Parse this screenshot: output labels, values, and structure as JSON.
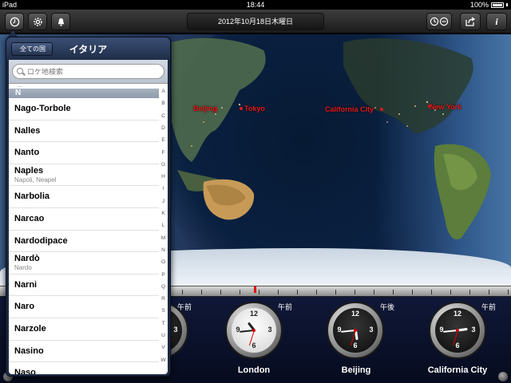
{
  "status_bar": {
    "device": "iPad",
    "time": "18:44",
    "battery": "100%"
  },
  "toolbar": {
    "date": "2012年10月18日木曜日",
    "left_buttons": [
      "clock-icon",
      "gear-icon",
      "bell-icon"
    ],
    "right_buttons": [
      "dual-clock-icon",
      "share-icon",
      "info-icon"
    ],
    "info_label": "i"
  },
  "map": {
    "cities": [
      {
        "name": "Beijing"
      },
      {
        "name": "Tokyo"
      },
      {
        "name": "California City"
      },
      {
        "name": "New York"
      }
    ]
  },
  "clocks": [
    {
      "name": "",
      "ampm": "午前",
      "hour": 8,
      "minute": 44,
      "second": 22,
      "face": "dark"
    },
    {
      "name": "London",
      "ampm": "午前",
      "hour": 10,
      "minute": 44,
      "second": 33,
      "face": "light"
    },
    {
      "name": "Beijing",
      "ampm": "午後",
      "hour": 5,
      "minute": 44,
      "second": 33,
      "face": "dark"
    },
    {
      "name": "California City",
      "ampm": "午前",
      "hour": 2,
      "minute": 44,
      "second": 33,
      "face": "dark"
    }
  ],
  "popover": {
    "back_button": "全ての国",
    "title": "イタリア",
    "search_placeholder": "ロケ地検索",
    "dots": "...",
    "section": "N",
    "items": [
      {
        "name": "Nago-Torbole",
        "alt": ""
      },
      {
        "name": "Nalles",
        "alt": ""
      },
      {
        "name": "Nanto",
        "alt": ""
      },
      {
        "name": "Naples",
        "alt": "Napoli, Neapel"
      },
      {
        "name": "Narbolia",
        "alt": ""
      },
      {
        "name": "Narcao",
        "alt": ""
      },
      {
        "name": "Nardodipace",
        "alt": ""
      },
      {
        "name": "Nardò",
        "alt": "Nardo"
      },
      {
        "name": "Narni",
        "alt": ""
      },
      {
        "name": "Naro",
        "alt": ""
      },
      {
        "name": "Narzole",
        "alt": ""
      },
      {
        "name": "Nasino",
        "alt": ""
      },
      {
        "name": "Naso",
        "alt": ""
      }
    ],
    "index": [
      "A",
      "B",
      "C",
      "D",
      "E",
      "F",
      "G",
      "H",
      "I",
      "J",
      "K",
      "L",
      "M",
      "N",
      "O",
      "P",
      "Q",
      "R",
      "S",
      "T",
      "U",
      "V",
      "W"
    ]
  }
}
